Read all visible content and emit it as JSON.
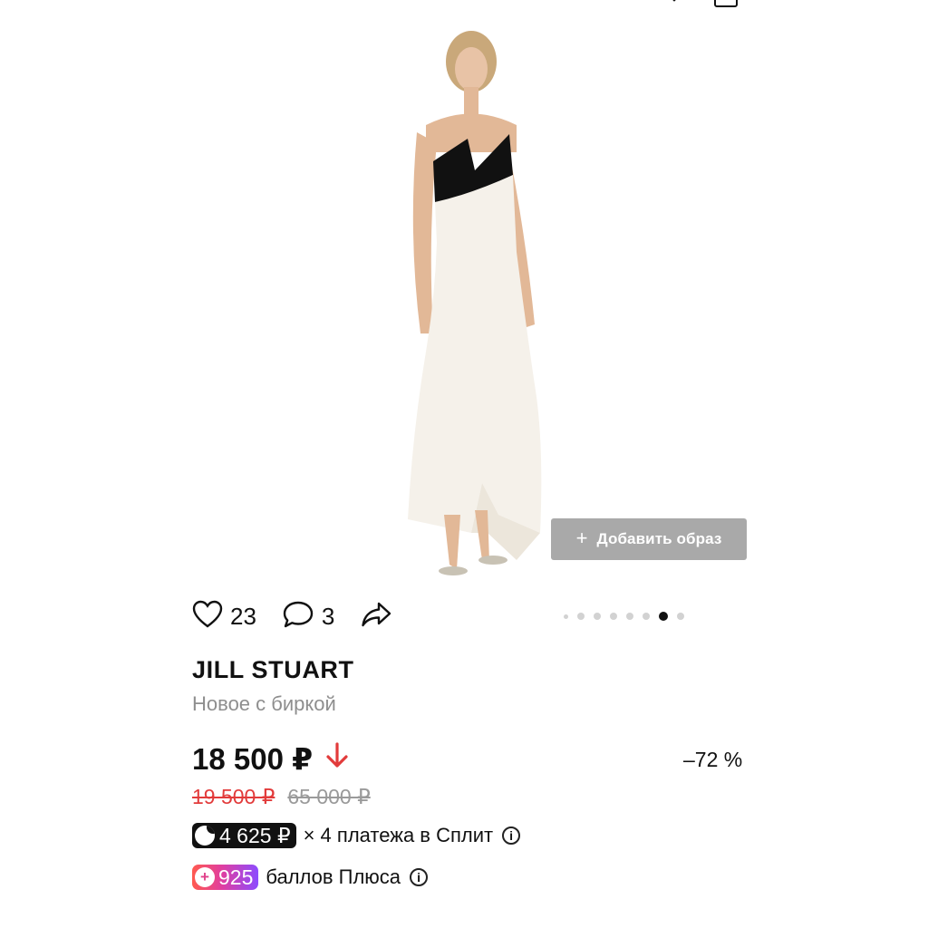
{
  "product": {
    "image_alt": "Платье JILL STUART",
    "add_look_label": "Добавить образ",
    "likes": "23",
    "comments": "3",
    "gallery": {
      "total": 8,
      "active_index": 6
    },
    "brand": "JILL STUART",
    "condition": "Новое с биркой",
    "price": "18 500 ₽",
    "discount": "–72 %",
    "previous_price": "19 500 ₽",
    "original_price": "65 000 ₽",
    "split": {
      "amount": "4 625 ₽",
      "text": "× 4 платежа в Сплит"
    },
    "plus": {
      "points": "925",
      "text": "баллов Плюса"
    }
  },
  "colors": {
    "accent_red": "#e23b3b",
    "muted": "#8e8e8e",
    "button_gray": "#a9a9a9"
  }
}
